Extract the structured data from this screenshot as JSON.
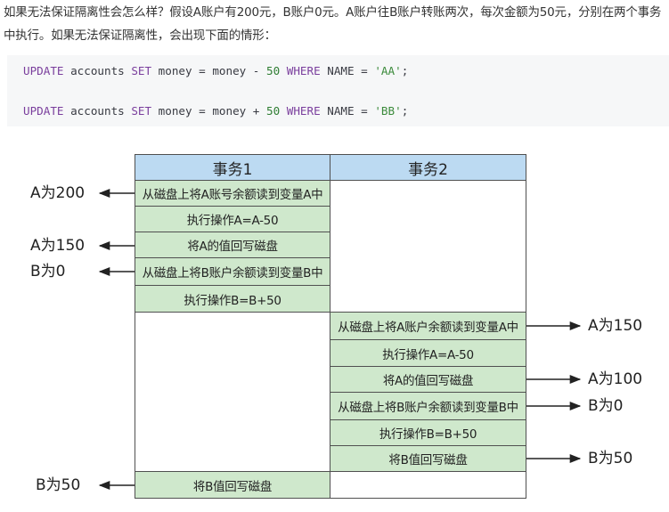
{
  "intro_text": "如果无法保证隔离性会怎么样？假设A账户有200元，B账户0元。A账户往B账户转账两次，每次金额为50元，分别在两个事务中执行。如果无法保证隔离性，会出现下面的情形：",
  "code": {
    "line1": {
      "kw1": "UPDATE",
      "t1": " accounts ",
      "kw2": "SET",
      "t2": " money = money - ",
      "num": "50",
      "t3": " ",
      "kw3": "WHERE",
      "t4": " NAME = ",
      "str": "'AA'",
      "t5": ";"
    },
    "line2": {
      "kw1": "UPDATE",
      "t1": " accounts ",
      "kw2": "SET",
      "t2": " money = money + ",
      "num": "50",
      "t3": " ",
      "kw3": "WHERE",
      "t4": " NAME = ",
      "str": "'BB'",
      "t5": ";"
    }
  },
  "table": {
    "headers": [
      "事务1",
      "事务2"
    ],
    "tx1_steps": [
      "从磁盘上将A账号余额读到变量A中",
      "执行操作A=A-50",
      "将A的值回写磁盘",
      "从磁盘上将B账户余额读到变量B中",
      "执行操作B=B+50"
    ],
    "tx2_steps": [
      "从磁盘上将A账户余额读到变量A中",
      "执行操作A=A-50",
      "将A的值回写磁盘",
      "从磁盘上将B账户余额读到变量B中",
      "执行操作B=B+50",
      "将B值回写磁盘"
    ],
    "tx1_final_step": "将B值回写磁盘"
  },
  "left_labels": [
    "A为200",
    "A为150",
    "B为0",
    "B为50"
  ],
  "right_labels": [
    "A为150",
    "A为100",
    "B为0",
    "B为50"
  ],
  "colors": {
    "header": "#bcdaf2",
    "step": "#cfe8cc",
    "border": "#505050"
  }
}
